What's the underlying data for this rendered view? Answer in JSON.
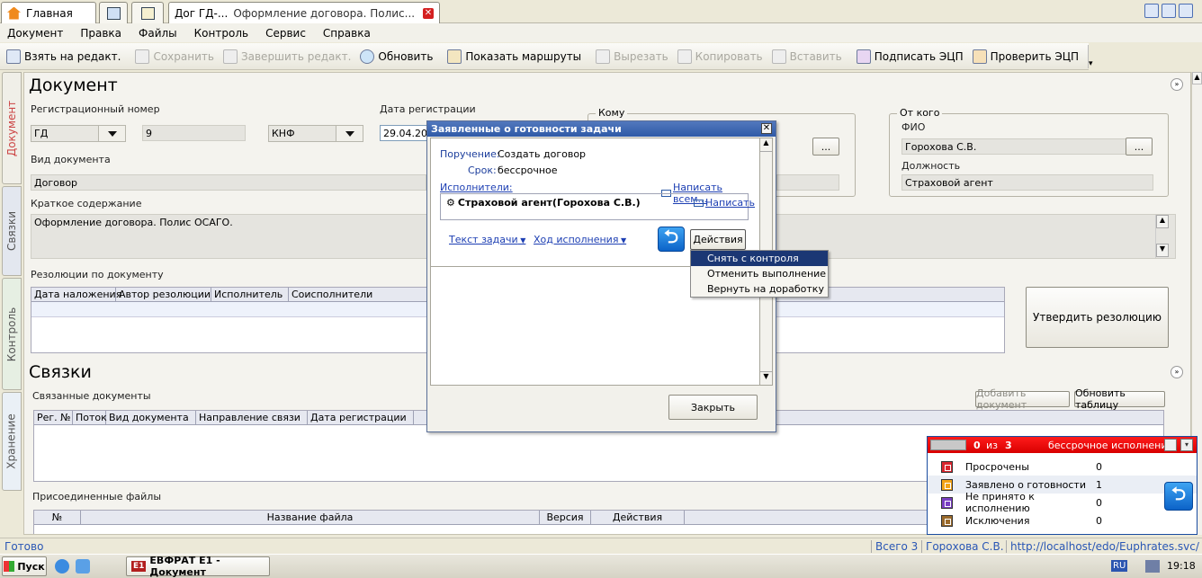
{
  "tabs": {
    "home": "Главная",
    "doc_tab_short": "Дог ГД-...",
    "doc_tab_title": "Оформление договора. Полис..."
  },
  "menu": [
    "Документ",
    "Правка",
    "Файлы",
    "Контроль",
    "Сервис",
    "Справка"
  ],
  "toolbar": {
    "take_edit": "Взять на редакт.",
    "save": "Сохранить",
    "finish_edit": "Завершить редакт.",
    "refresh": "Обновить",
    "show_routes": "Показать маршруты",
    "cut": "Вырезать",
    "copy": "Копировать",
    "paste": "Вставить",
    "sign": "Подписать ЭЦП",
    "verify": "Проверить ЭЦП"
  },
  "side_tabs": [
    "Документ",
    "Связки",
    "Контроль",
    "Хранение"
  ],
  "document": {
    "title": "Документ",
    "reg_number_label": "Регистрационный номер",
    "reg_prefix": "ГД",
    "reg_num": "9",
    "reg_suffix": "КНФ",
    "reg_date_label": "Дата регистрации",
    "reg_date": "29.04.20",
    "doc_type_label": "Вид документа",
    "doc_type": "Договор",
    "summary_label": "Краткое содержание",
    "summary": "Оформление договора. Полис ОСАГО.",
    "to_label": "Кому",
    "from_label": "От кого",
    "fio_label": "ФИО",
    "fio": "Горохова С.В.",
    "position_label": "Должность",
    "position": "Страховой агент",
    "ellipsis": "...",
    "resolutions_label": "Резолюции по документу",
    "res_cols": [
      "Дата наложения",
      "Автор резолюции",
      "Исполнитель",
      "Соисполнители"
    ],
    "approve_btn": "Утвердить резолюцию"
  },
  "links": {
    "title": "Связки",
    "related_label": "Связанные документы",
    "add_doc": "Добавить документ",
    "refresh_table": "Обновить таблицу",
    "cols": [
      "Рег. №",
      "Поток",
      "Вид документа",
      "Направление связи",
      "Дата регистрации"
    ],
    "files_label": "Присоединенные файлы",
    "file_cols": [
      "№",
      "Название файла",
      "Версия",
      "Действия"
    ]
  },
  "dialog": {
    "title": "Заявленные о готовности задачи",
    "task_label": "Поручение:",
    "task": "Создать договор",
    "term_label": "Срок:",
    "term": "бессрочное",
    "executors_label": "Исполнители:",
    "write_all": "Написать всем...",
    "executor": "Страховой агент(Горохова С.В.)",
    "write": "Написать",
    "task_text": "Текст задачи",
    "progress": "Ход исполнения",
    "actions": "Действия",
    "close": "Закрыть"
  },
  "context_menu": [
    "Снять с контроля",
    "Отменить выполнение",
    "Вернуть на доработку"
  ],
  "notify": {
    "count": "0",
    "of": "из",
    "total": "3",
    "mode": "бессрочное исполнение",
    "rows": [
      {
        "label": "Просрочены",
        "value": "0",
        "color": "#d9262f"
      },
      {
        "label": "Заявлено о готовности",
        "value": "1",
        "color": "#f3a316"
      },
      {
        "label": "Не принято к исполнению",
        "value": "0",
        "color": "#7a3fc2"
      },
      {
        "label": "Исключения",
        "value": "0",
        "color": "#9a6a2b"
      }
    ]
  },
  "status": {
    "ready": "Готово",
    "total": "Всего 3",
    "user": "Горохова С.В.",
    "url": "http://localhost/edo/Euphrates.svc/"
  },
  "taskbar": {
    "start": "Пуск",
    "app": "ЕВФРАТ Е1 - Документ",
    "app_icon": "E1",
    "lang": "RU",
    "time": "19:18"
  }
}
